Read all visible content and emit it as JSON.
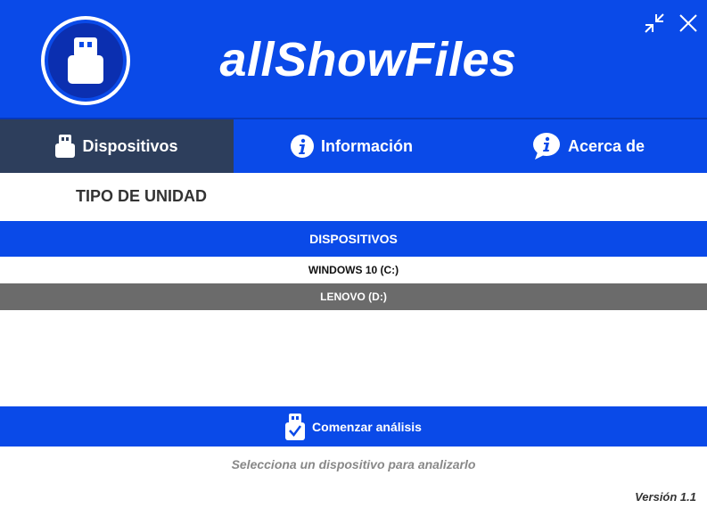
{
  "app": {
    "title": "allShowFiles"
  },
  "tabs": [
    {
      "label": "Dispositivos",
      "icon": "usb-drive-icon",
      "active": true
    },
    {
      "label": "Información",
      "icon": "info-circle-icon",
      "active": false
    },
    {
      "label": "Acerca de",
      "icon": "info-bubble-icon",
      "active": false
    }
  ],
  "section": {
    "title": "TIPO DE UNIDAD"
  },
  "devices": {
    "header": "DISPOSITIVOS",
    "items": [
      "WINDOWS 10 (C:)",
      "LENOVO (D:)"
    ]
  },
  "actions": {
    "start_label": "Comenzar análisis"
  },
  "footer": {
    "hint": "Selecciona un dispositivo para analizarlo",
    "version": "Versión 1.1"
  },
  "colors": {
    "primary": "#0a4ae8",
    "active_tab": "#2d3e5c",
    "selected_row": "#6b6b6b"
  }
}
